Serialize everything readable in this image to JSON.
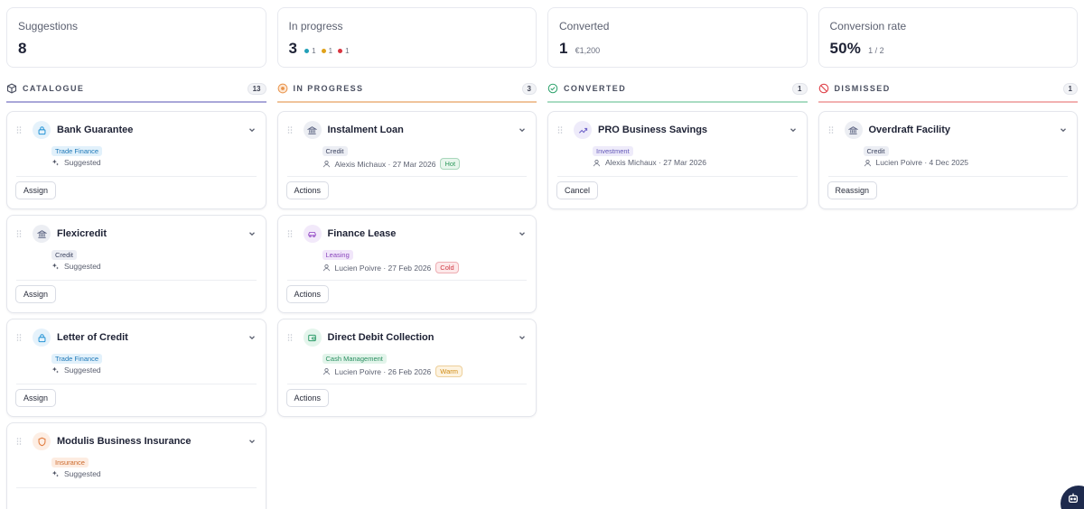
{
  "stats": [
    {
      "label": "Suggestions",
      "value": "8"
    },
    {
      "label": "In progress",
      "value": "3",
      "dots": [
        {
          "n": "1",
          "color": "#22a0b8"
        },
        {
          "n": "1",
          "color": "#e0a21b"
        },
        {
          "n": "1",
          "color": "#d9343f"
        }
      ]
    },
    {
      "label": "Converted",
      "value": "1",
      "sub": "€1,200"
    },
    {
      "label": "Conversion rate",
      "value": "50%",
      "sub": "1 / 2"
    }
  ],
  "columns": [
    {
      "title": "CATALOGUE",
      "count": "13",
      "color": "#a9a7d9",
      "icon": "box-icon",
      "cards": [
        {
          "title": "Bank Guarantee",
          "icon": "lock-icon",
          "iconColor": "#2795d6",
          "iconBg": "#e5f2fb",
          "tag": "Trade Finance",
          "tagColor": "#1f79b8",
          "tagBg": "#e2f1fb",
          "meta": "Suggested",
          "metaIcon": "sparkle-icon",
          "action": "Assign"
        },
        {
          "title": "Flexicredit",
          "icon": "bank-icon",
          "iconColor": "#5a6280",
          "iconBg": "#eceef3",
          "tag": "Credit",
          "tagColor": "#3d4460",
          "tagBg": "#eceef4",
          "meta": "Suggested",
          "metaIcon": "sparkle-icon",
          "action": "Assign"
        },
        {
          "title": "Letter of Credit",
          "icon": "lock-icon",
          "iconColor": "#2795d6",
          "iconBg": "#e5f2fb",
          "tag": "Trade Finance",
          "tagColor": "#1f79b8",
          "tagBg": "#e2f1fb",
          "meta": "Suggested",
          "metaIcon": "sparkle-icon",
          "action": "Assign"
        },
        {
          "title": "Modulis Business Insurance",
          "icon": "shield-icon",
          "iconColor": "#e0793a",
          "iconBg": "#fdeee4",
          "tag": "Insurance",
          "tagColor": "#cc6a2c",
          "tagBg": "#fdece1",
          "meta": "Suggested",
          "metaIcon": "sparkle-icon",
          "action": ""
        }
      ]
    },
    {
      "title": "IN PROGRESS",
      "count": "3",
      "color": "#f0c49b",
      "icon": "progress-icon",
      "cards": [
        {
          "title": "Instalment Loan",
          "icon": "bank-icon",
          "iconColor": "#5a6280",
          "iconBg": "#eceef3",
          "tag": "Credit",
          "tagColor": "#3d4460",
          "tagBg": "#eceef4",
          "meta": "Alexis Michaux · 27 Mar 2026",
          "metaIcon": "user-icon",
          "badge": "Hot",
          "badgeColor": "#2f9a5e",
          "badgeBg": "#e7f6ec",
          "action": "Actions"
        },
        {
          "title": "Finance Lease",
          "icon": "car-icon",
          "iconColor": "#9a55c9",
          "iconBg": "#f2e9fa",
          "tag": "Leasing",
          "tagColor": "#8a47bd",
          "tagBg": "#f1e6fa",
          "meta": "Lucien Poivre · 27 Feb 2026",
          "metaIcon": "user-icon",
          "badge": "Cold",
          "badgeColor": "#cf3a44",
          "badgeBg": "#fde9ea",
          "action": "Actions"
        },
        {
          "title": "Direct Debit Collection",
          "icon": "wallet-icon",
          "iconColor": "#2e9c6a",
          "iconBg": "#e4f5ec",
          "tag": "Cash Management",
          "tagColor": "#2a8f61",
          "tagBg": "#e2f4ea",
          "meta": "Lucien Poivre · 26 Feb 2026",
          "metaIcon": "user-icon",
          "badge": "Warm",
          "badgeColor": "#d08a12",
          "badgeBg": "#fdf3e0",
          "action": "Actions"
        }
      ]
    },
    {
      "title": "CONVERTED",
      "count": "1",
      "color": "#a9dcc3",
      "icon": "check-circle-icon",
      "cards": [
        {
          "title": "PRO Business Savings",
          "icon": "trend-icon",
          "iconColor": "#6b5fc7",
          "iconBg": "#eeebfa",
          "tag": "Investment",
          "tagColor": "#6358b8",
          "tagBg": "#eeebfa",
          "meta": "Alexis Michaux · 27 Mar 2026",
          "metaIcon": "user-icon",
          "action": "Cancel"
        }
      ]
    },
    {
      "title": "DISMISSED",
      "count": "1",
      "color": "#f2b1b1",
      "icon": "ban-icon",
      "cards": [
        {
          "title": "Overdraft Facility",
          "icon": "bank-icon",
          "iconColor": "#5a6280",
          "iconBg": "#eceef3",
          "tag": "Credit",
          "tagColor": "#3d4460",
          "tagBg": "#eceef4",
          "meta": "Lucien Poivre · 4 Dec 2025",
          "metaIcon": "user-icon",
          "action": "Reassign"
        }
      ]
    }
  ],
  "fab": {
    "icon": "robot-icon"
  }
}
